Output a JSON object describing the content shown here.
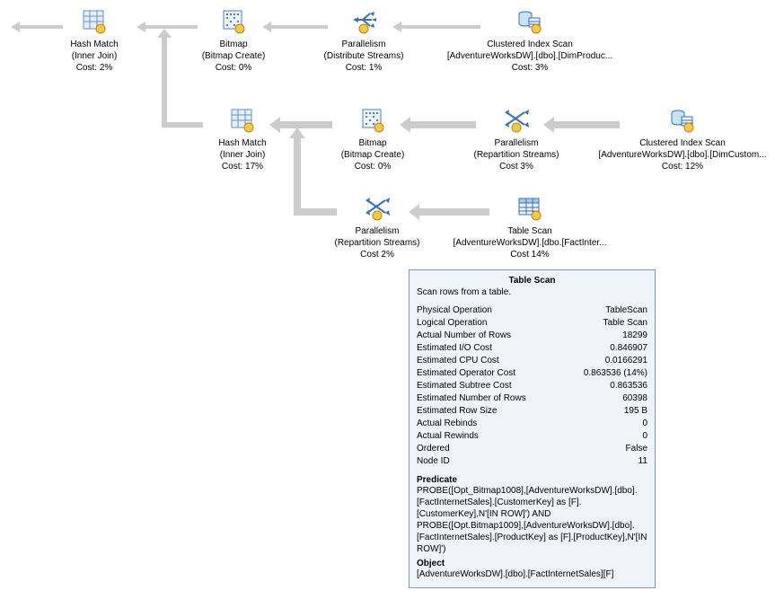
{
  "nodes": {
    "hashMatch1": {
      "line1": "Hash Match",
      "line2": "(Inner Join)",
      "line3": "Cost: 2%"
    },
    "bitmap1": {
      "line1": "Bitmap",
      "line2": "(Bitmap Create)",
      "line3": "Cost: 0%"
    },
    "parallel1": {
      "line1": "Parallelism",
      "line2": "(Distribute Streams)",
      "line3": "Cost: 1%"
    },
    "cis1": {
      "line1": "Clustered Index Scan",
      "line2": "[AdventureWorksDW].[dbo].[DimProduc...",
      "line3": "Cost: 3%"
    },
    "hashMatch2": {
      "line1": "Hash Match",
      "line2": "(Inner Join)",
      "line3": "Cost: 17%"
    },
    "bitmap2": {
      "line1": "Bitmap",
      "line2": "(Bitmap Create)",
      "line3": "Cost: 0%"
    },
    "parallel2": {
      "line1": "Parallelism",
      "line2": "(Repartition Streams)",
      "line3": "Cost 3%"
    },
    "cis2": {
      "line1": "Clustered Index Scan",
      "line2": "[AdventureWorksDW].[dbo].[DimCustom...",
      "line3": "Cost: 12%"
    },
    "parallel3": {
      "line1": "Parallelism",
      "line2": "(Repartition Streams)",
      "line3": "Cost 2%"
    },
    "tableScan": {
      "line1": "Table Scan",
      "line2": "[AdventureWorksDW].[dbo.[FactInter...",
      "line3": "Cost 14%"
    }
  },
  "tooltip": {
    "title": "Table Scan",
    "desc": "Scan rows from a table.",
    "rows": [
      {
        "k": "Physical Operation",
        "v": "TableScan"
      },
      {
        "k": "Logical Operation",
        "v": "Table Scan"
      },
      {
        "k": "Actual Number of Rows",
        "v": "18299"
      },
      {
        "k": "Estimated I/O Cost",
        "v": "0.846907"
      },
      {
        "k": "Estimated CPU Cost",
        "v": "0.0166291"
      },
      {
        "k": "Estimated Operator Cost",
        "v": "0.863536 (14%)"
      },
      {
        "k": "Estimated Subtree Cost",
        "v": "0.863536"
      },
      {
        "k": "Estimated Number of Rows",
        "v": "60398"
      },
      {
        "k": "Estimated Row Size",
        "v": "195 B"
      },
      {
        "k": "Actual Rebinds",
        "v": "0"
      },
      {
        "k": "Actual Rewinds",
        "v": "0"
      },
      {
        "k": "Ordered",
        "v": "False"
      },
      {
        "k": "Node ID",
        "v": "11"
      }
    ],
    "predicateTitle": "Predicate",
    "predicate": "PROBE([Opt_Bitmap1008],[AdventureWorksDW].[dbo].[FactInternetSales].[CustomerKey] as [F].[CustomerKey],N'[IN ROW]') AND PROBE([Opt.Bitmap1009],[AdventureWorksDW].[dbo].[FactInternetSales].[ProductKey] as [F].[ProductKey],N'[IN ROW]')",
    "objectTitle": "Object",
    "object": "[AdventureWorksDW].[dbo].[FactInternetSales][F]"
  }
}
